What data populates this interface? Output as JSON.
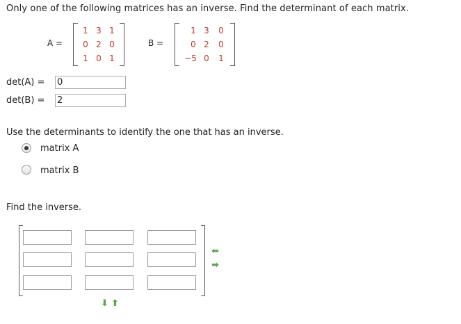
{
  "question": "Only one of the following matrices has an inverse. Find the determinant of each matrix.",
  "matrix_a": {
    "label": "A =",
    "rows": [
      [
        "1",
        "3",
        "1"
      ],
      [
        "0",
        "2",
        "0"
      ],
      [
        "1",
        "0",
        "1"
      ]
    ]
  },
  "matrix_b": {
    "label": "B =",
    "rows": [
      [
        "1",
        "3",
        "0"
      ],
      [
        "0",
        "2",
        "0"
      ],
      [
        "−5",
        "0",
        "1"
      ]
    ]
  },
  "det_a": {
    "label": "det(A) =",
    "value": "0"
  },
  "det_b": {
    "label": "det(B) =",
    "value": "2"
  },
  "instruction": "Use the determinants to identify the one that has an inverse.",
  "options": [
    {
      "label": "matrix A",
      "selected": true
    },
    {
      "label": "matrix B",
      "selected": false
    }
  ],
  "inverse_prompt": "Find the inverse.",
  "colors": {
    "matrix_entry": "#c0392b",
    "arrow": "#5aa64a"
  },
  "icons": [
    "arrow-left-icon",
    "arrow-right-icon",
    "arrow-down-icon",
    "arrow-up-icon"
  ]
}
